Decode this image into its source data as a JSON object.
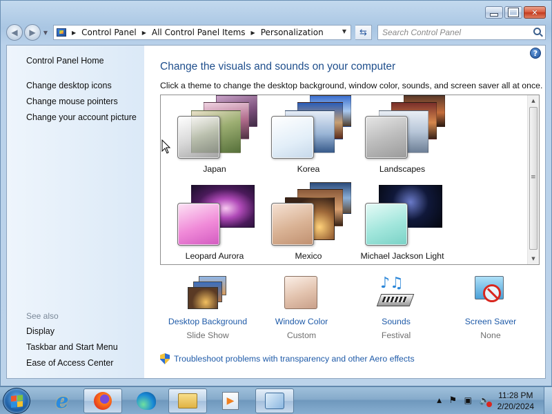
{
  "window": {
    "address_crumbs": [
      "Control Panel",
      "All Control Panel Items",
      "Personalization"
    ],
    "search_placeholder": "Search Control Panel"
  },
  "sidebar": {
    "home": "Control Panel Home",
    "links": [
      "Change desktop icons",
      "Change mouse pointers",
      "Change your account picture"
    ],
    "see_also_title": "See also",
    "see_also": [
      "Display",
      "Taskbar and Start Menu",
      "Ease of Access Center"
    ]
  },
  "main": {
    "heading": "Change the visuals and sounds on your computer",
    "subheading": "Click a theme to change the desktop background, window color, sounds, and screen saver all at once.",
    "themes": [
      {
        "name": "Japan"
      },
      {
        "name": "Korea"
      },
      {
        "name": "Landscapes"
      },
      {
        "name": "Leopard Aurora"
      },
      {
        "name": "Mexico"
      },
      {
        "name": "Michael Jackson Light"
      }
    ],
    "categories": [
      {
        "name": "Desktop Background",
        "value": "Slide Show",
        "icon": "desktop-background-icon"
      },
      {
        "name": "Window Color",
        "value": "Custom",
        "icon": "window-color-icon"
      },
      {
        "name": "Sounds",
        "value": "Festival",
        "icon": "sounds-icon"
      },
      {
        "name": "Screen Saver",
        "value": "None",
        "icon": "screen-saver-icon"
      }
    ],
    "troubleshoot": "Troubleshoot problems with transparency and other Aero effects"
  },
  "taskbar": {
    "time": "11:28 PM",
    "date": "2/20/2024"
  },
  "colors": {
    "link_blue": "#1e5aa8",
    "heading_blue": "#1e4e8c"
  }
}
